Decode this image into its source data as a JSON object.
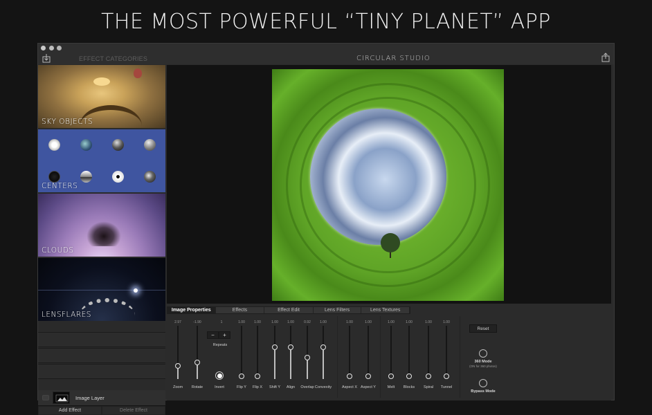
{
  "headline": "THE MOST POWERFUL “TINY PLANET” APP",
  "window": {
    "title": "CIRCULAR  STUDIO",
    "sidebar_header": "EFFECT CATEGORIES"
  },
  "categories": [
    {
      "label": "SKY OBJECTS"
    },
    {
      "label": "CENTERS"
    },
    {
      "label": "CLOUDS"
    },
    {
      "label": "LENSFLARES"
    }
  ],
  "layers": {
    "items": [
      {
        "name": "Image Layer"
      }
    ],
    "add_label": "Add Effect",
    "delete_label": "Delete Effect"
  },
  "tabs": [
    {
      "label": "Image Properties",
      "active": true
    },
    {
      "label": "Effects",
      "active": false
    },
    {
      "label": "Effect Edit",
      "active": false
    },
    {
      "label": "Lens Filters",
      "active": false
    },
    {
      "label": "Lens Textures",
      "active": false
    }
  ],
  "sliders": [
    {
      "name": "Zoom",
      "value": "2.97",
      "level": 0.2
    },
    {
      "name": "Rotate",
      "value": "-1.90",
      "level": 0.26
    },
    {
      "name": "Flip Y",
      "value": "1.00",
      "level": 0
    },
    {
      "name": "Flip X",
      "value": "1.00",
      "level": 0
    },
    {
      "name": "Shift Y",
      "value": "1.00",
      "level": 0.55
    },
    {
      "name": "Align",
      "value": "1.00",
      "level": 0.55
    },
    {
      "name": "Overlap",
      "value": "0.92",
      "level": 0.35
    },
    {
      "name": "Convexity",
      "value": "1.00",
      "level": 0.55
    },
    {
      "name": "Aspect X",
      "value": "1.00",
      "level": 0
    },
    {
      "name": "Aspect Y",
      "value": "1.00",
      "level": 0
    },
    {
      "name": "Melt",
      "value": "1.00",
      "level": 0
    },
    {
      "name": "Blocks",
      "value": "1.00",
      "level": 0
    },
    {
      "name": "Spiral",
      "value": "1.00",
      "level": 0
    },
    {
      "name": "Tunnel",
      "value": "1.00",
      "level": 0
    }
  ],
  "repeats": {
    "value": "1",
    "label": "Repeats",
    "minus": "−",
    "plus": "+"
  },
  "invert": {
    "label": "Invert",
    "checked": true
  },
  "reset_label": "Reset",
  "mode_360": {
    "label": "360 Mode",
    "sub": "(ON for 360 photos)",
    "checked": false
  },
  "bypass": {
    "label": "Bypass Mode",
    "checked": false
  }
}
